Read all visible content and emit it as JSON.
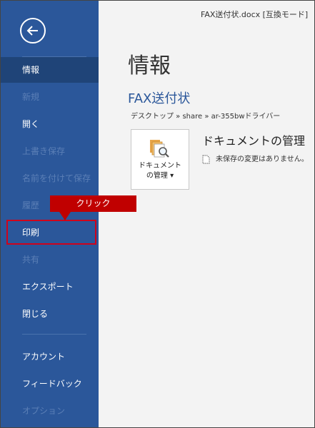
{
  "window": {
    "title": "FAX送付状.docx [互換モード]"
  },
  "sidebar": {
    "items": [
      {
        "label": "情報",
        "state": "active"
      },
      {
        "label": "新規",
        "state": "disabled"
      },
      {
        "label": "開く",
        "state": "enabled"
      },
      {
        "label": "上書き保存",
        "state": "disabled"
      },
      {
        "label": "名前を付けて保存",
        "state": "disabled"
      },
      {
        "label": "履歴",
        "state": "disabled"
      },
      {
        "label": "印刷",
        "state": "enabled"
      },
      {
        "label": "共有",
        "state": "disabled"
      },
      {
        "label": "エクスポート",
        "state": "enabled"
      },
      {
        "label": "閉じる",
        "state": "enabled"
      },
      {
        "label": "アカウント",
        "state": "enabled"
      },
      {
        "label": "フィードバック",
        "state": "enabled"
      },
      {
        "label": "オプション",
        "state": "disabled"
      }
    ]
  },
  "annotation": {
    "callout": "クリック"
  },
  "main": {
    "page_title": "情報",
    "doc_title": "FAX送付状",
    "breadcrumb": "デスクトップ » share » ar-355bwドライバー",
    "manage_button": {
      "line1": "ドキュメント",
      "line2": "の管理 ▾"
    },
    "section_title": "ドキュメントの管理",
    "status_text": "未保存の変更はありません。"
  },
  "colors": {
    "sidebar": "#2b579a",
    "active_item": "#1f4478",
    "callout": "#c00000",
    "highlight": "#d0021b",
    "accent_text": "#2b579a"
  }
}
